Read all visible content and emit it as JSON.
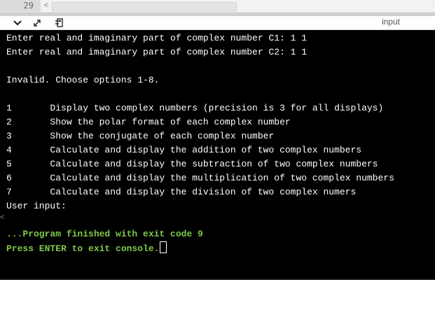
{
  "editor": {
    "line_number": "29",
    "scroll_left_glyph": "<"
  },
  "toolbar": {
    "input_label": "input",
    "icons": [
      "chevron-down-icon",
      "expand-icon",
      "clear-console-icon"
    ]
  },
  "console": {
    "lines": [
      {
        "text": "Enter real and imaginary part of complex number C1: 1 1",
        "style": "normal"
      },
      {
        "text": "Enter real and imaginary part of complex number C2: 1 1",
        "style": "normal"
      },
      {
        "text": "",
        "style": "normal"
      },
      {
        "text": "Invalid. Choose options 1-8.",
        "style": "normal"
      },
      {
        "text": "",
        "style": "normal"
      },
      {
        "text": "1       Display two complex numbers (precision is 3 for all displays)",
        "style": "normal"
      },
      {
        "text": "2       Show the polar format of each complex number",
        "style": "normal"
      },
      {
        "text": "3       Show the conjugate of each complex number",
        "style": "normal"
      },
      {
        "text": "4       Calculate and display the addition of two complex numbers",
        "style": "normal"
      },
      {
        "text": "5       Calculate and display the subtraction of two complex numbers",
        "style": "normal"
      },
      {
        "text": "6       Calculate and display the multiplication of two complex numbers",
        "style": "normal"
      },
      {
        "text": "7       Calculate and display the division of two complex numers",
        "style": "normal"
      },
      {
        "text": "User input:",
        "style": "normal"
      },
      {
        "text": "",
        "style": "normal"
      },
      {
        "text": "...Program finished with exit code 9",
        "style": "green"
      },
      {
        "text": "Press ENTER to exit console.",
        "style": "green",
        "cursor": true
      }
    ]
  },
  "colors": {
    "console_background": "#000000",
    "console_text": "#ffffff",
    "console_highlight": "#7ec94b"
  }
}
